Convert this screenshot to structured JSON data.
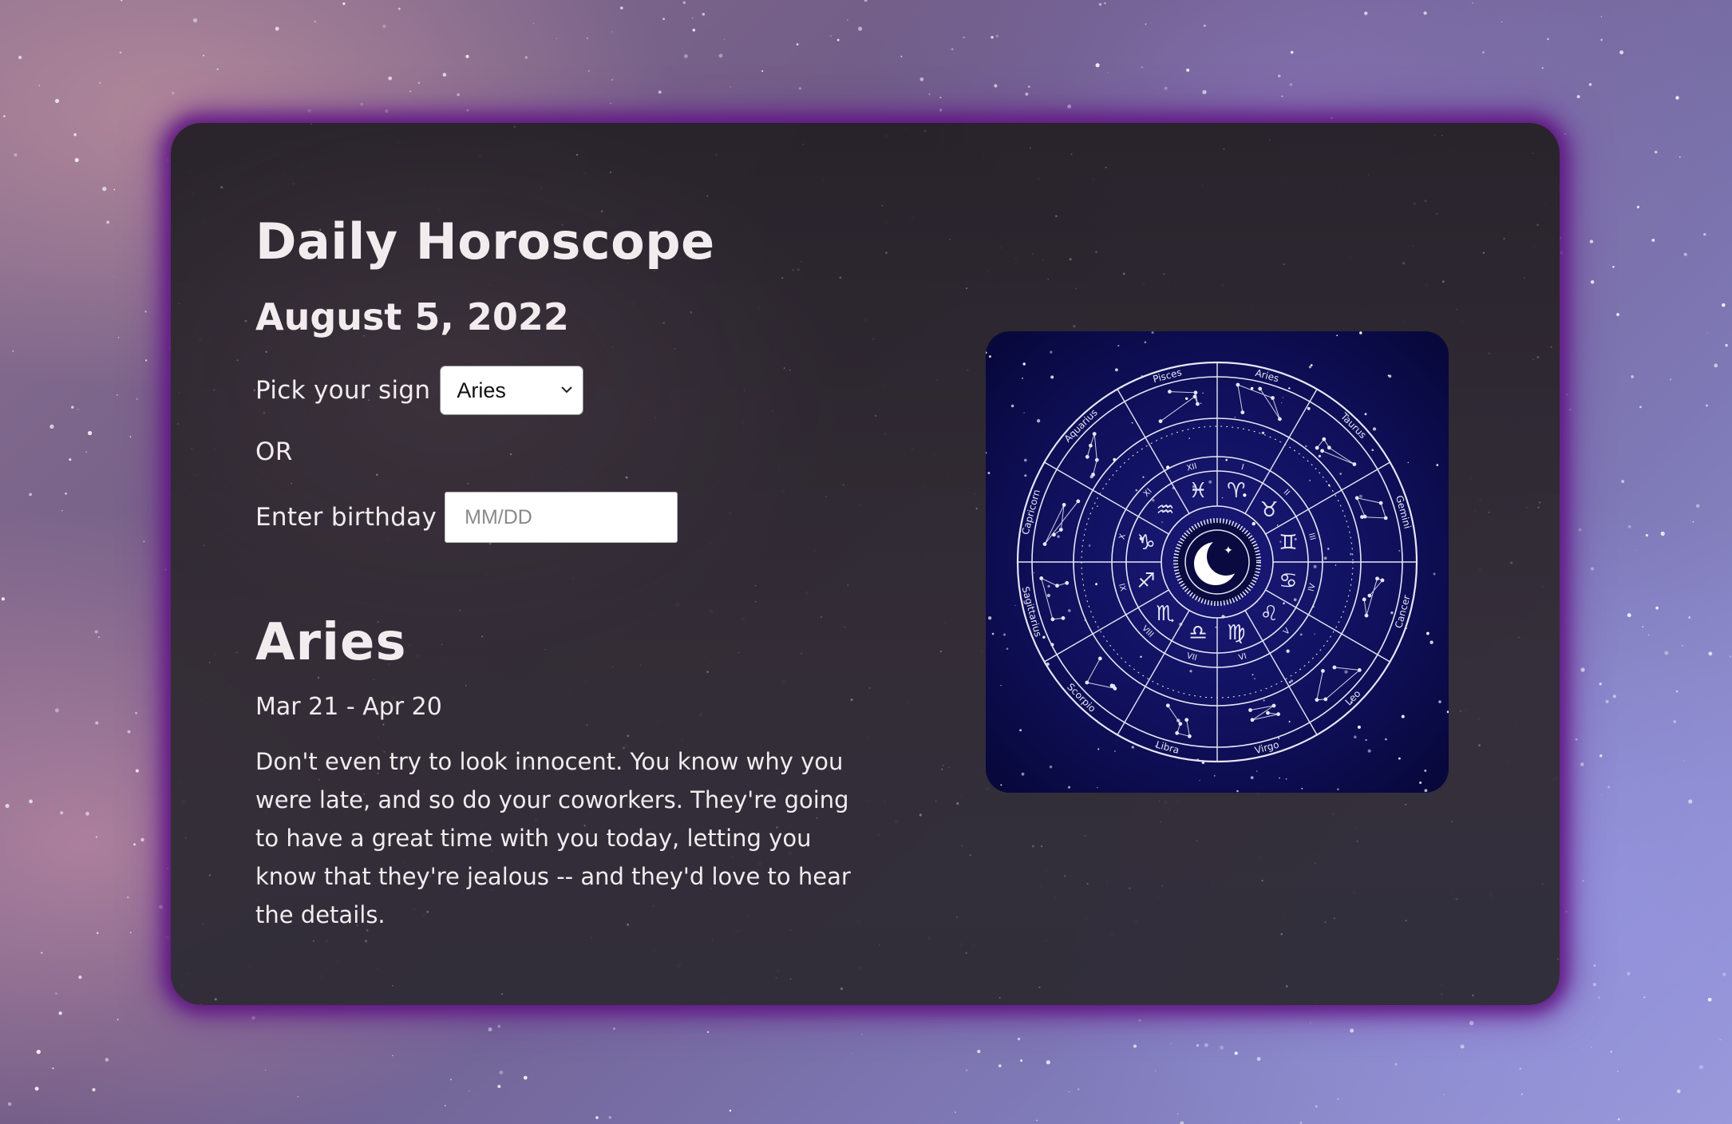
{
  "page": {
    "title": "Daily Horoscope",
    "date": "August 5, 2022"
  },
  "sign_picker": {
    "label": "Pick your sign",
    "selected": "Aries"
  },
  "separator": "OR",
  "birthday": {
    "label": "Enter birthday",
    "placeholder": "MM/DD",
    "value": ""
  },
  "horoscope": {
    "sign": "Aries",
    "date_range": "Mar 21 - Apr 20",
    "reading": "Don't even try to look innocent. You know why you were late, and so do your coworkers. They're going to have a great time with you today, letting you know that they're jealous -- and they'd love to hear the details."
  },
  "zodiac_wheel": {
    "signs": [
      "Pisces",
      "Aries",
      "Taurus",
      "Gemini",
      "Cancer",
      "Leo",
      "Virgo",
      "Libra",
      "Scorpio",
      "Sagittarius",
      "Capricorn",
      "Aquarius"
    ],
    "numerals": [
      "XII",
      "I",
      "II",
      "III",
      "IV",
      "V",
      "VI",
      "VII",
      "VIII",
      "IX",
      "X",
      "XI"
    ],
    "glyphs": [
      "♓",
      "♈",
      "♉",
      "♊",
      "♋",
      "♌",
      "♍",
      "♎",
      "♏",
      "♐",
      "♑",
      "♒"
    ],
    "colors": {
      "background": "#0f0f5a",
      "lines": "#e6e6f5"
    }
  },
  "theme": {
    "card_glow": "#5f1482",
    "text": "#f2ecef"
  }
}
